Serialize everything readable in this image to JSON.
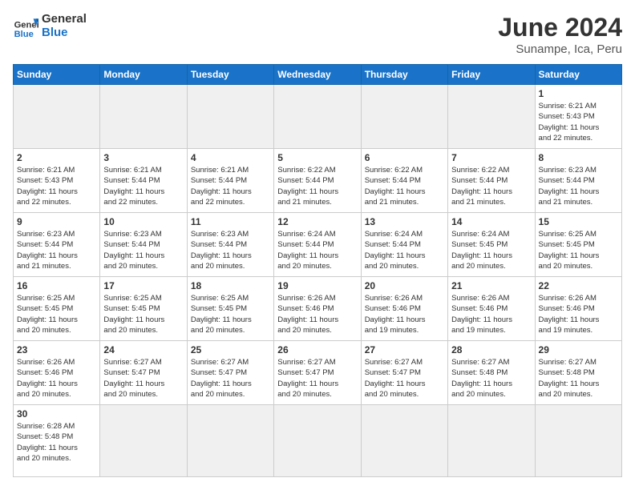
{
  "header": {
    "logo_general": "General",
    "logo_blue": "Blue",
    "title": "June 2024",
    "subtitle": "Sunampe, Ica, Peru"
  },
  "days_of_week": [
    "Sunday",
    "Monday",
    "Tuesday",
    "Wednesday",
    "Thursday",
    "Friday",
    "Saturday"
  ],
  "weeks": [
    {
      "days": [
        {
          "num": "",
          "info": ""
        },
        {
          "num": "",
          "info": ""
        },
        {
          "num": "",
          "info": ""
        },
        {
          "num": "",
          "info": ""
        },
        {
          "num": "",
          "info": ""
        },
        {
          "num": "",
          "info": ""
        },
        {
          "num": "1",
          "info": "Sunrise: 6:21 AM\nSunset: 5:43 PM\nDaylight: 11 hours\nand 22 minutes."
        }
      ]
    },
    {
      "days": [
        {
          "num": "2",
          "info": "Sunrise: 6:21 AM\nSunset: 5:43 PM\nDaylight: 11 hours\nand 22 minutes."
        },
        {
          "num": "3",
          "info": "Sunrise: 6:21 AM\nSunset: 5:44 PM\nDaylight: 11 hours\nand 22 minutes."
        },
        {
          "num": "4",
          "info": "Sunrise: 6:21 AM\nSunset: 5:44 PM\nDaylight: 11 hours\nand 22 minutes."
        },
        {
          "num": "5",
          "info": "Sunrise: 6:22 AM\nSunset: 5:44 PM\nDaylight: 11 hours\nand 21 minutes."
        },
        {
          "num": "6",
          "info": "Sunrise: 6:22 AM\nSunset: 5:44 PM\nDaylight: 11 hours\nand 21 minutes."
        },
        {
          "num": "7",
          "info": "Sunrise: 6:22 AM\nSunset: 5:44 PM\nDaylight: 11 hours\nand 21 minutes."
        },
        {
          "num": "8",
          "info": "Sunrise: 6:23 AM\nSunset: 5:44 PM\nDaylight: 11 hours\nand 21 minutes."
        }
      ]
    },
    {
      "days": [
        {
          "num": "9",
          "info": "Sunrise: 6:23 AM\nSunset: 5:44 PM\nDaylight: 11 hours\nand 21 minutes."
        },
        {
          "num": "10",
          "info": "Sunrise: 6:23 AM\nSunset: 5:44 PM\nDaylight: 11 hours\nand 20 minutes."
        },
        {
          "num": "11",
          "info": "Sunrise: 6:23 AM\nSunset: 5:44 PM\nDaylight: 11 hours\nand 20 minutes."
        },
        {
          "num": "12",
          "info": "Sunrise: 6:24 AM\nSunset: 5:44 PM\nDaylight: 11 hours\nand 20 minutes."
        },
        {
          "num": "13",
          "info": "Sunrise: 6:24 AM\nSunset: 5:44 PM\nDaylight: 11 hours\nand 20 minutes."
        },
        {
          "num": "14",
          "info": "Sunrise: 6:24 AM\nSunset: 5:45 PM\nDaylight: 11 hours\nand 20 minutes."
        },
        {
          "num": "15",
          "info": "Sunrise: 6:25 AM\nSunset: 5:45 PM\nDaylight: 11 hours\nand 20 minutes."
        }
      ]
    },
    {
      "days": [
        {
          "num": "16",
          "info": "Sunrise: 6:25 AM\nSunset: 5:45 PM\nDaylight: 11 hours\nand 20 minutes."
        },
        {
          "num": "17",
          "info": "Sunrise: 6:25 AM\nSunset: 5:45 PM\nDaylight: 11 hours\nand 20 minutes."
        },
        {
          "num": "18",
          "info": "Sunrise: 6:25 AM\nSunset: 5:45 PM\nDaylight: 11 hours\nand 20 minutes."
        },
        {
          "num": "19",
          "info": "Sunrise: 6:26 AM\nSunset: 5:46 PM\nDaylight: 11 hours\nand 20 minutes."
        },
        {
          "num": "20",
          "info": "Sunrise: 6:26 AM\nSunset: 5:46 PM\nDaylight: 11 hours\nand 19 minutes."
        },
        {
          "num": "21",
          "info": "Sunrise: 6:26 AM\nSunset: 5:46 PM\nDaylight: 11 hours\nand 19 minutes."
        },
        {
          "num": "22",
          "info": "Sunrise: 6:26 AM\nSunset: 5:46 PM\nDaylight: 11 hours\nand 19 minutes."
        }
      ]
    },
    {
      "days": [
        {
          "num": "23",
          "info": "Sunrise: 6:26 AM\nSunset: 5:46 PM\nDaylight: 11 hours\nand 20 minutes."
        },
        {
          "num": "24",
          "info": "Sunrise: 6:27 AM\nSunset: 5:47 PM\nDaylight: 11 hours\nand 20 minutes."
        },
        {
          "num": "25",
          "info": "Sunrise: 6:27 AM\nSunset: 5:47 PM\nDaylight: 11 hours\nand 20 minutes."
        },
        {
          "num": "26",
          "info": "Sunrise: 6:27 AM\nSunset: 5:47 PM\nDaylight: 11 hours\nand 20 minutes."
        },
        {
          "num": "27",
          "info": "Sunrise: 6:27 AM\nSunset: 5:47 PM\nDaylight: 11 hours\nand 20 minutes."
        },
        {
          "num": "28",
          "info": "Sunrise: 6:27 AM\nSunset: 5:48 PM\nDaylight: 11 hours\nand 20 minutes."
        },
        {
          "num": "29",
          "info": "Sunrise: 6:27 AM\nSunset: 5:48 PM\nDaylight: 11 hours\nand 20 minutes."
        }
      ]
    },
    {
      "days": [
        {
          "num": "30",
          "info": "Sunrise: 6:28 AM\nSunset: 5:48 PM\nDaylight: 11 hours\nand 20 minutes."
        },
        {
          "num": "",
          "info": ""
        },
        {
          "num": "",
          "info": ""
        },
        {
          "num": "",
          "info": ""
        },
        {
          "num": "",
          "info": ""
        },
        {
          "num": "",
          "info": ""
        },
        {
          "num": "",
          "info": ""
        }
      ]
    }
  ]
}
